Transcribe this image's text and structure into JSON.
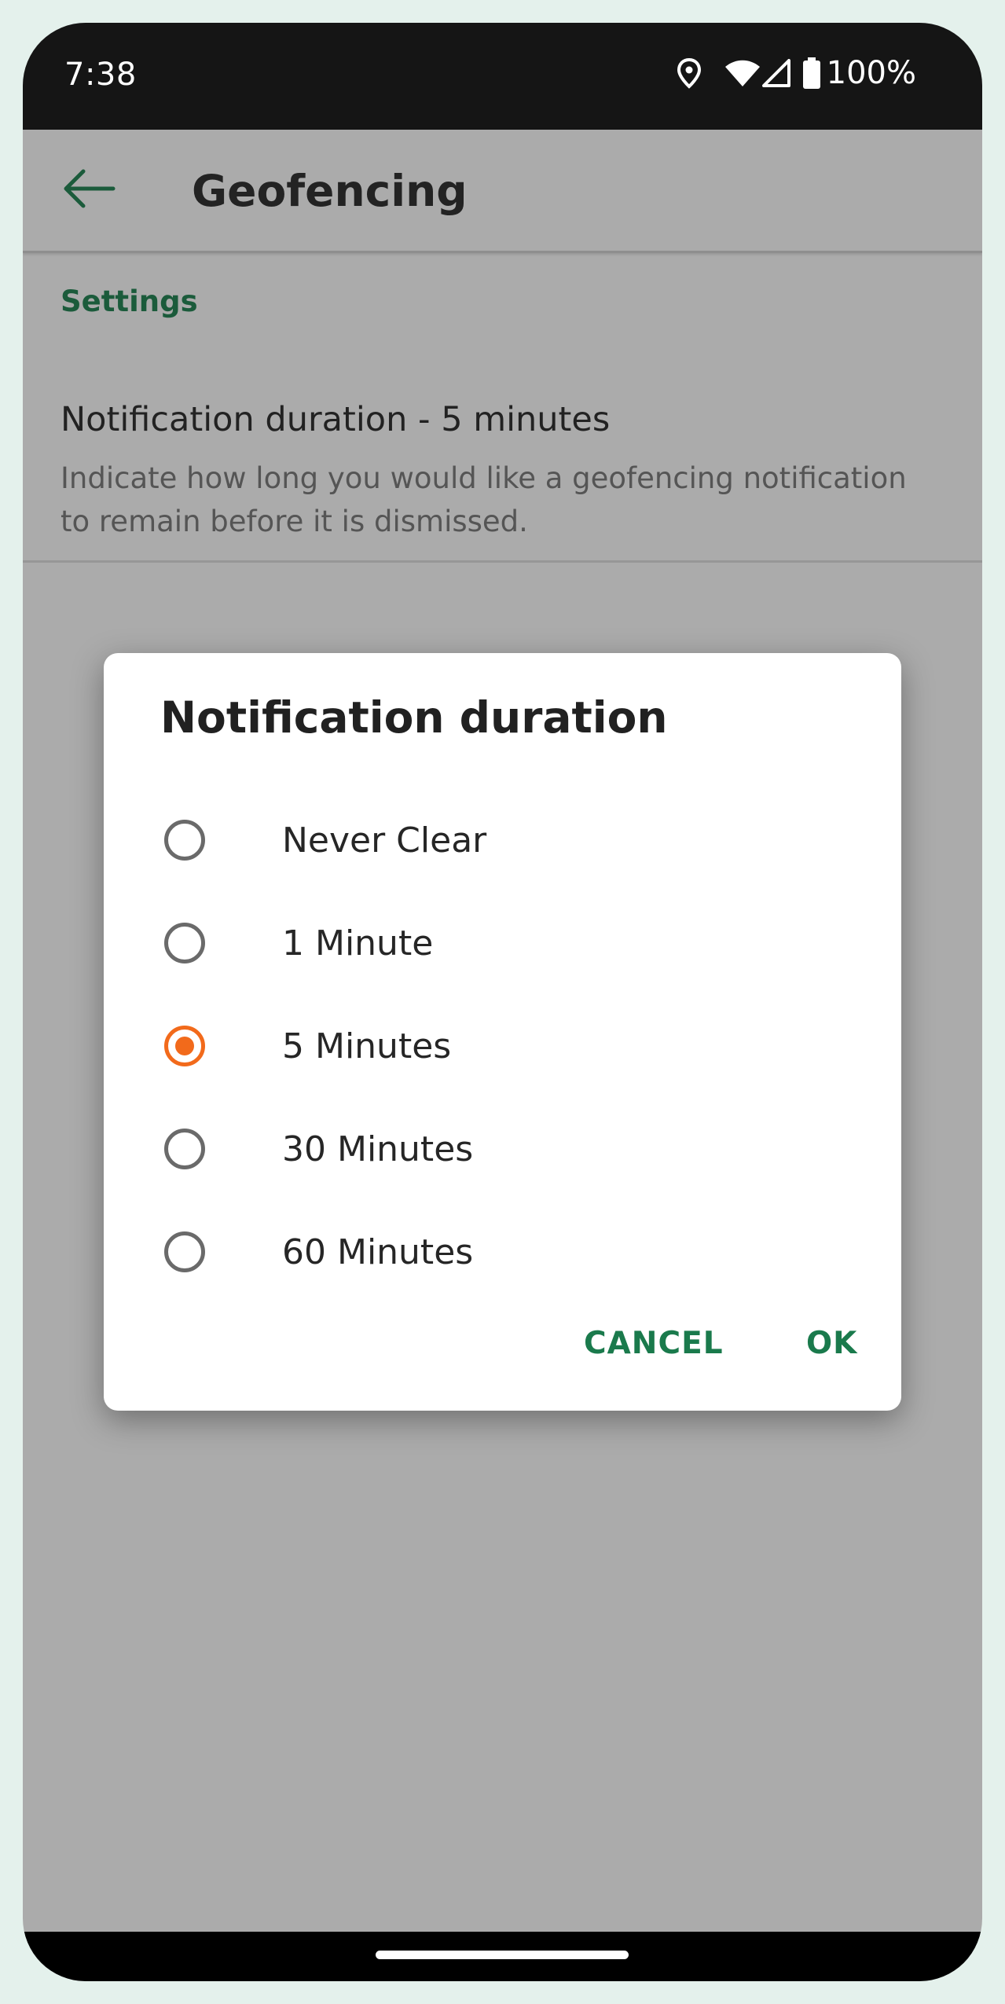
{
  "status_bar": {
    "time": "7:38",
    "battery_percent": "100%",
    "icons": [
      "location-icon",
      "wifi-icon",
      "cell-signal-icon",
      "battery-icon"
    ]
  },
  "app_bar": {
    "title": "Geofencing",
    "back_icon": "back-arrow-icon"
  },
  "settings": {
    "section_header": "Settings",
    "notification_pref": {
      "title": "Notification duration - 5 minutes",
      "summary": "Indicate how long you would like a geofencing notification to remain before it is dismissed."
    }
  },
  "dialog": {
    "title": "Notification duration",
    "options": [
      {
        "label": "Never Clear",
        "selected": false
      },
      {
        "label": "1 Minute",
        "selected": false
      },
      {
        "label": "5 Minutes",
        "selected": true
      },
      {
        "label": "30 Minutes",
        "selected": false
      },
      {
        "label": "60 Minutes",
        "selected": false
      }
    ],
    "cancel_label": "CANCEL",
    "ok_label": "OK"
  },
  "colors": {
    "accent_green": "#1a7a4c",
    "radio_selected": "#f26a1b",
    "scrim": "#ababab"
  }
}
